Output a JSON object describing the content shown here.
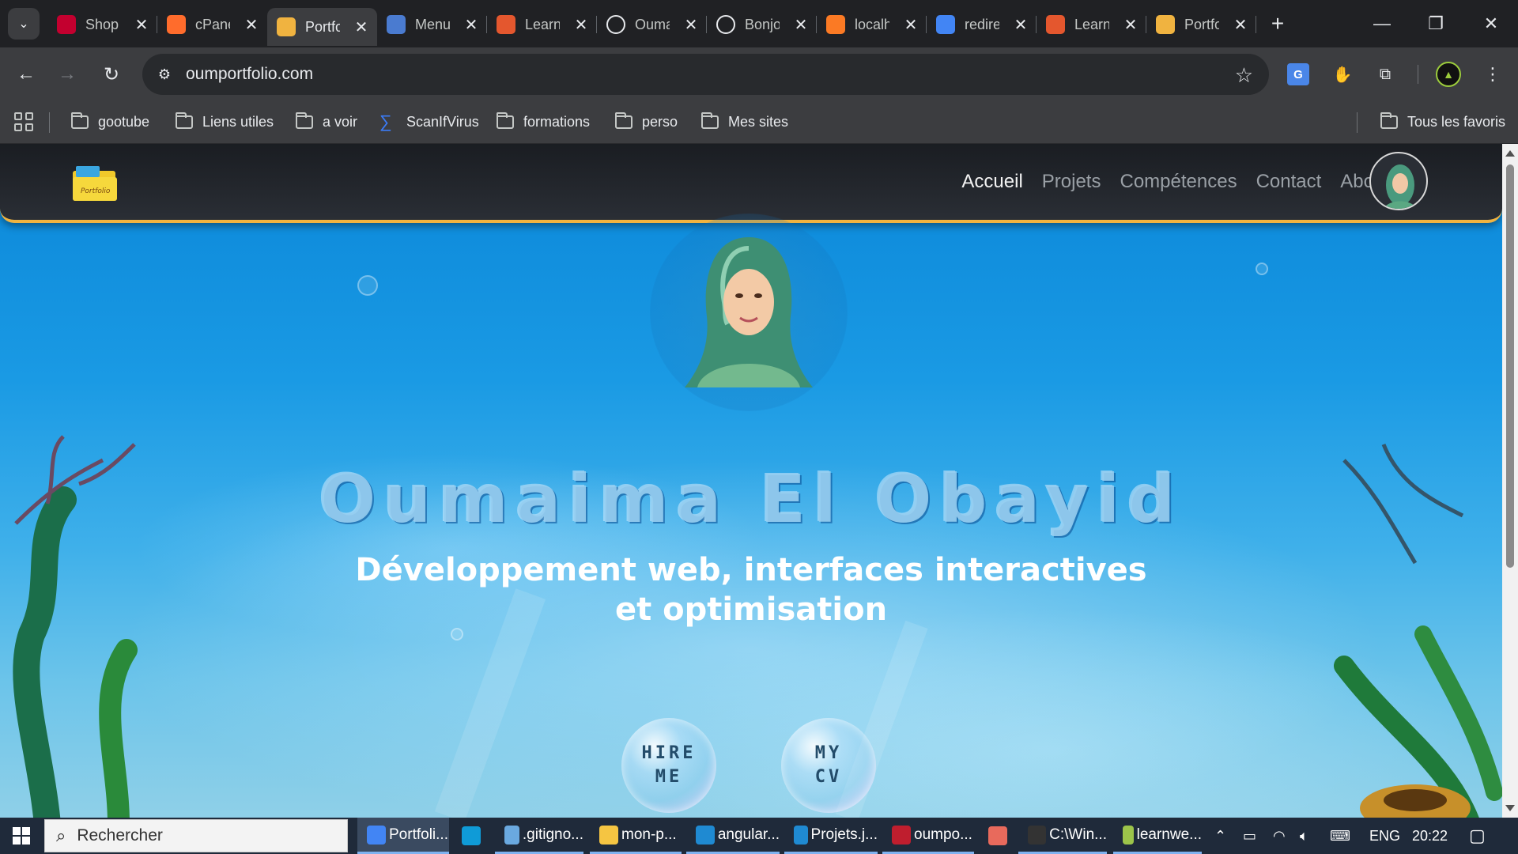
{
  "browser": {
    "tabs": [
      {
        "label": "Shop",
        "favicon": "angular-icon",
        "color": "#c3002f"
      },
      {
        "label": "cPanel",
        "favicon": "cpanel-icon",
        "color": "#ff6c2c"
      },
      {
        "label": "Portfolio",
        "favicon": "portfolio-icon",
        "color": "#f0b340",
        "active": true
      },
      {
        "label": "Menu",
        "favicon": "grid-icon",
        "color": "#4a7bd0"
      },
      {
        "label": "Learn",
        "favicon": "learn-icon",
        "color": "#e4572e"
      },
      {
        "label": "Oumaima",
        "favicon": "github-icon",
        "color": "#ffffff"
      },
      {
        "label": "Bonjour",
        "favicon": "openai-icon",
        "color": "#ffffff"
      },
      {
        "label": "localhost",
        "favicon": "xampp-icon",
        "color": "#fb7a24"
      },
      {
        "label": "redirect",
        "favicon": "google-icon",
        "color": "#4285f4"
      },
      {
        "label": "Learn",
        "favicon": "learn-icon",
        "color": "#e4572e"
      },
      {
        "label": "Portfolio",
        "favicon": "portfolio-icon",
        "color": "#f0b340"
      }
    ],
    "url": "oumportfolio.com",
    "bookmarks": {
      "items": [
        "gootube",
        "Liens utiles",
        "a voir",
        "ScanIfVirus",
        "formations",
        "perso",
        "Mes sites"
      ],
      "all_favorites": "Tous les favoris"
    }
  },
  "site": {
    "nav": {
      "links": [
        "Accueil",
        "Projets",
        "Compétences",
        "Contact",
        "About"
      ],
      "active": "Accueil",
      "logo_text": "Portfolio"
    },
    "hero": {
      "name": "Oumaima El Obayid",
      "subtitle": "Développement web, interfaces interactives et optimisation",
      "buttons": [
        "HIRE ME",
        "MY CV"
      ]
    },
    "accent": "#f0b340"
  },
  "taskbar": {
    "search_placeholder": "Rechercher",
    "items": [
      {
        "label": "Portfoli...",
        "icon": "chrome-icon",
        "color": "#4285f4"
      },
      {
        "label": "",
        "icon": "edge-icon",
        "color": "#0f9bd7"
      },
      {
        "label": ".gitigno...",
        "icon": "notepad-icon",
        "color": "#6aa9e0"
      },
      {
        "label": "mon-p...",
        "icon": "folder-icon",
        "color": "#f5c542"
      },
      {
        "label": "angular...",
        "icon": "vscode-icon",
        "color": "#1f8ad2"
      },
      {
        "label": "Projets.j...",
        "icon": "vscode-icon",
        "color": "#1f8ad2"
      },
      {
        "label": "oumpo...",
        "icon": "filezilla-icon",
        "color": "#bf1e2e"
      },
      {
        "label": "",
        "icon": "paint-icon",
        "color": "#e86a5c"
      },
      {
        "label": "C:\\Win...",
        "icon": "cmd-icon",
        "color": "#333333"
      },
      {
        "label": "learnwe...",
        "icon": "app-icon",
        "color": "#9cc44a"
      }
    ],
    "lang": "ENG",
    "time": "20:22"
  }
}
